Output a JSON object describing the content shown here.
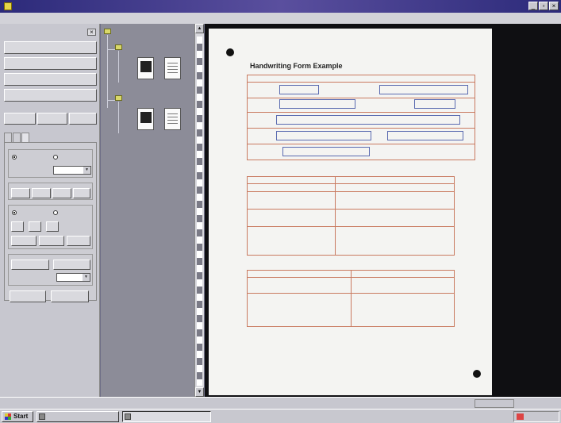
{
  "window": {
    "title": "",
    "buttons": {
      "min": "_",
      "max": "▫",
      "close": "×"
    }
  },
  "menubar": {
    "items": [
      "",
      "",
      "",
      ""
    ]
  },
  "leftpane": {
    "close_label": "×",
    "buttons": [
      "",
      "",
      "",
      ""
    ],
    "small_buttons": [
      "",
      "",
      ""
    ],
    "tabs": [
      "",
      "",
      ""
    ],
    "mini_buttons": [
      "",
      "",
      "",
      "",
      "",
      "",
      "",
      "",
      "",
      ""
    ],
    "bottom_buttons": [
      "",
      ""
    ]
  },
  "tree": {
    "folders": [
      "",
      ""
    ],
    "thumb_captions": [
      "",
      "",
      "",
      ""
    ]
  },
  "scrollbar": {
    "up": "▲",
    "down": "▼"
  },
  "document": {
    "form_title": "Handwriting Form Example",
    "section1_title": "",
    "section2_title": "",
    "section3_title": ""
  },
  "statusbar": {
    "left": "",
    "page": "",
    "right": ""
  },
  "taskbar": {
    "start": "Start",
    "items": [
      "",
      ""
    ],
    "clock": ""
  }
}
